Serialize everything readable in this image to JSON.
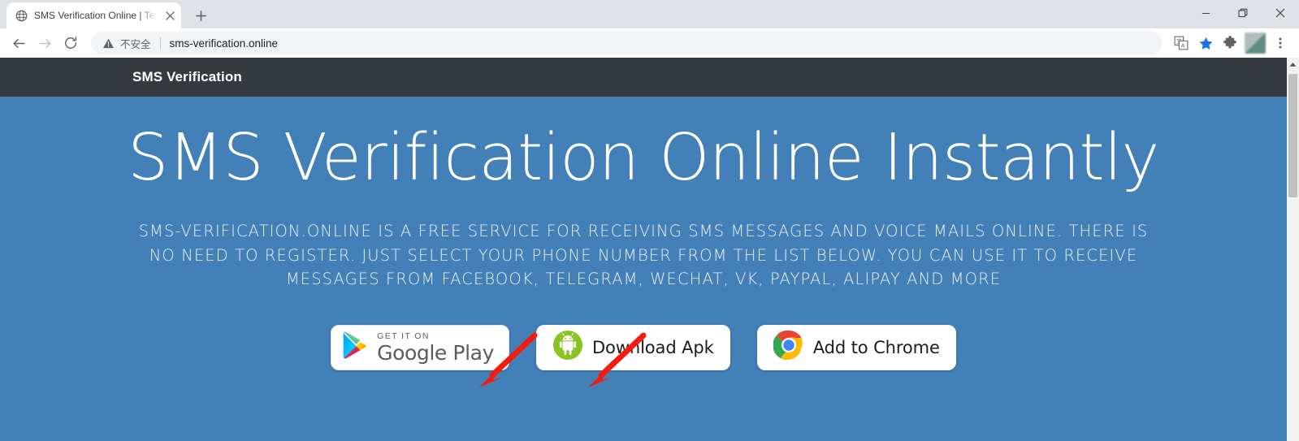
{
  "browser": {
    "tab": {
      "title": "SMS Verification Online | Tem",
      "favicon_icon": "globe-icon",
      "close_icon": "close-icon"
    },
    "new_tab_label": "+",
    "window_controls": [
      {
        "name": "minimize",
        "glyph": "—"
      },
      {
        "name": "restore",
        "glyph": "❐"
      },
      {
        "name": "close",
        "glyph": "✕"
      }
    ],
    "toolbar": {
      "back_icon": "back-arrow-icon",
      "forward_icon": "forward-arrow-icon",
      "reload_icon": "reload-icon",
      "security_icon": "warning-triangle-icon",
      "security_label": "不安全",
      "url": "sms-verification.online",
      "translate_icon": "translate-icon",
      "bookmark_icon": "star-icon",
      "extensions_icon": "puzzle-piece-icon",
      "profile_icon": "profile-avatar",
      "menu_icon": "three-dot-menu-icon"
    }
  },
  "page": {
    "navbar": {
      "brand": "SMS Verification"
    },
    "hero": {
      "heading": "SMS Verification Online Instantly",
      "paragraph": "sms-verification.online is a free service for receiving SMS messages and voice mails online. There is no need to register. Just select your phone number from the list below. You can use it to receive messages from Facebook, Telegram, WeChat, VK, PayPal, Alipay and more",
      "buttons": [
        {
          "name": "google-play",
          "icon": "google-play-triangle-icon",
          "small_label": "GET IT ON",
          "label": "Google Play"
        },
        {
          "name": "download-apk",
          "icon": "android-robot-icon",
          "label": "Download Apk"
        },
        {
          "name": "add-to-chrome",
          "icon": "chrome-logo-icon",
          "label": "Add to Chrome"
        }
      ]
    },
    "scrollbar": {
      "up_icon": "scroll-up-arrow-icon"
    }
  },
  "annotations": {
    "arrow_color": "#f51b0e",
    "arrows": [
      {
        "name": "arrow-to-google-play"
      },
      {
        "name": "arrow-to-download-apk"
      }
    ]
  },
  "colors": {
    "navbar_bg": "#343a40",
    "hero_bg": "#4280b7",
    "chrome_tabstrip": "#dee1e6",
    "omnibox_bg": "#f1f3f4"
  }
}
